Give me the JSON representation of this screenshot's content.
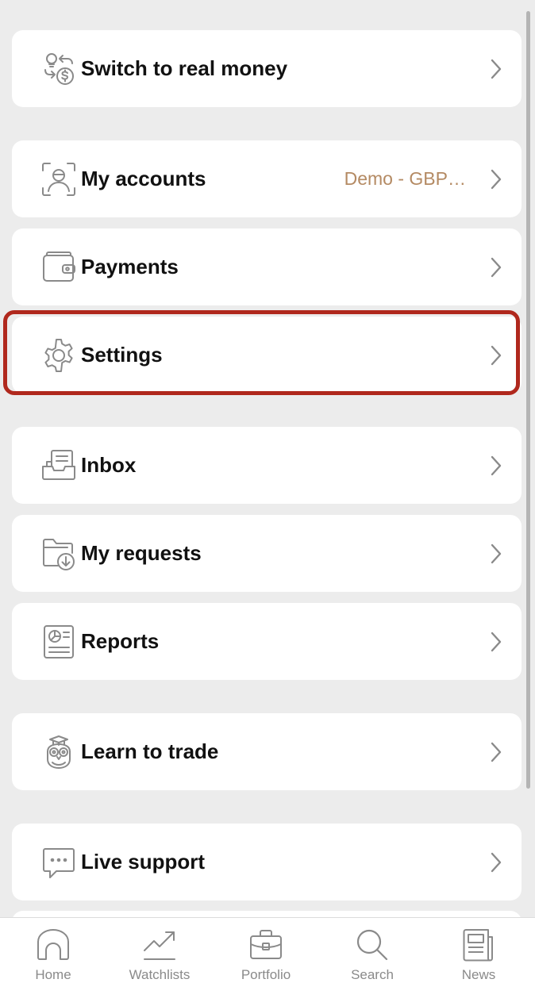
{
  "menu": {
    "switch_real_money": {
      "label": "Switch to real money",
      "icon": "switch-money-icon"
    },
    "my_accounts": {
      "label": "My accounts",
      "value": "Demo - GBP…",
      "icon": "account-icon"
    },
    "payments": {
      "label": "Payments",
      "icon": "wallet-icon"
    },
    "settings": {
      "label": "Settings",
      "icon": "gear-icon"
    },
    "inbox": {
      "label": "Inbox",
      "icon": "inbox-icon"
    },
    "my_requests": {
      "label": "My requests",
      "icon": "folder-download-icon"
    },
    "reports": {
      "label": "Reports",
      "icon": "report-icon"
    },
    "learn_to_trade": {
      "label": "Learn to trade",
      "icon": "owl-icon"
    },
    "live_support": {
      "label": "Live support",
      "icon": "chat-icon"
    }
  },
  "bottom_nav": {
    "home": "Home",
    "watchlists": "Watchlists",
    "portfolio": "Portfolio",
    "search": "Search",
    "news": "News"
  },
  "colors": {
    "background": "#ececec",
    "card": "#ffffff",
    "accent_value": "#b48a63",
    "highlight": "#b0281d",
    "icon": "#8a8a8a"
  }
}
